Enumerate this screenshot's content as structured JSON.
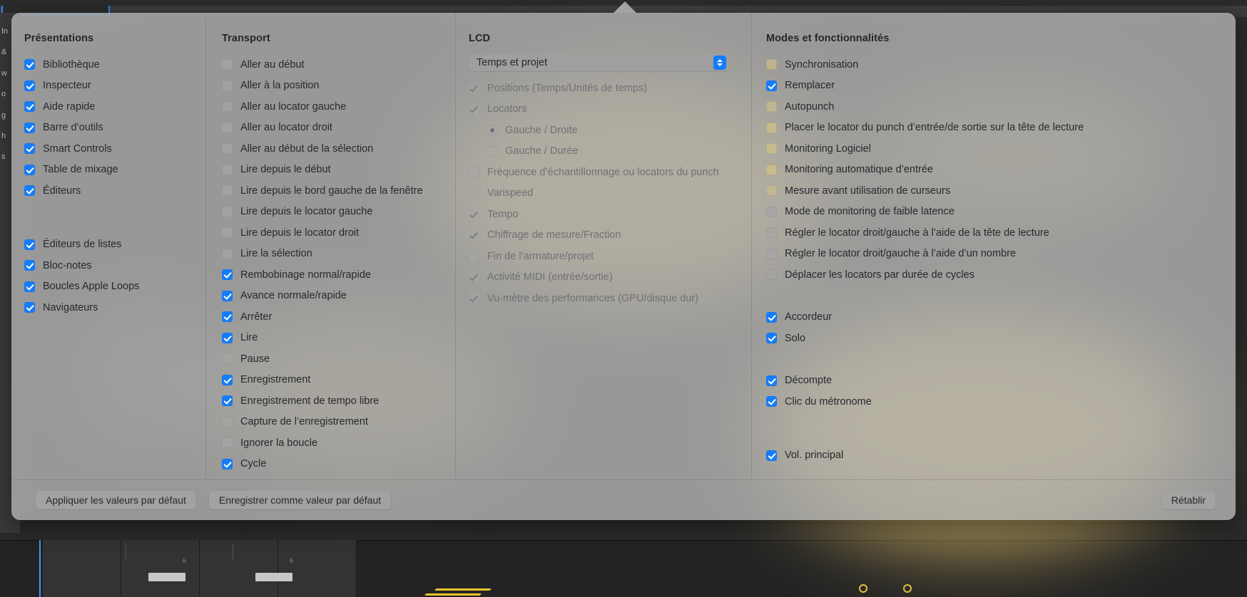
{
  "popover": {
    "columns": [
      {
        "id": "presentations",
        "title": "Présentations",
        "items": [
          {
            "label": "Bibliothèque",
            "state": "on"
          },
          {
            "label": "Inspecteur",
            "state": "on"
          },
          {
            "label": "Aide rapide",
            "state": "on"
          },
          {
            "label": "Barre d’outils",
            "state": "on"
          },
          {
            "label": "Smart Controls",
            "state": "on"
          },
          {
            "label": "Table de mixage",
            "state": "on"
          },
          {
            "label": "Éditeurs",
            "state": "on"
          },
          {
            "label": "Éditeurs de listes",
            "state": "on"
          },
          {
            "label": "Bloc-notes",
            "state": "on"
          },
          {
            "label": "Boucles Apple Loops",
            "state": "on"
          },
          {
            "label": "Navigateurs",
            "state": "on"
          }
        ]
      },
      {
        "id": "transport",
        "title": "Transport",
        "items": [
          {
            "label": "Aller au début",
            "state": "off"
          },
          {
            "label": "Aller à la position",
            "state": "off"
          },
          {
            "label": "Aller au locator gauche",
            "state": "off"
          },
          {
            "label": "Aller au locator droit",
            "state": "off"
          },
          {
            "label": "Aller au début de la sélection",
            "state": "off"
          },
          {
            "label": "Lire depuis le début",
            "state": "off"
          },
          {
            "label": "Lire depuis le bord gauche de la fenêtre",
            "state": "off"
          },
          {
            "label": "Lire depuis le locator gauche",
            "state": "off"
          },
          {
            "label": "Lire depuis le locator droit",
            "state": "off"
          },
          {
            "label": "Lire la sélection",
            "state": "off"
          },
          {
            "label": "Rembobinage normal/rapide",
            "state": "on"
          },
          {
            "label": "Avance normale/rapide",
            "state": "on"
          },
          {
            "label": "Arrêter",
            "state": "on"
          },
          {
            "label": "Lire",
            "state": "on"
          },
          {
            "label": "Pause",
            "state": "off"
          },
          {
            "label": "Enregistrement",
            "state": "on"
          },
          {
            "label": "Enregistrement de tempo libre",
            "state": "on"
          },
          {
            "label": "Capture de l’enregistrement",
            "state": "off"
          },
          {
            "label": "Ignorer la boucle",
            "state": "off"
          },
          {
            "label": "Cycle",
            "state": "on"
          }
        ]
      },
      {
        "id": "lcd",
        "title": "LCD",
        "popup": {
          "value": "Temps et projet"
        },
        "items": [
          {
            "label": "Positions (Temps/Unités de temps)",
            "state": "disabled-checked"
          },
          {
            "label": "Locators",
            "state": "disabled-checked"
          },
          {
            "label": "Gauche / Droite",
            "state": "radio-selected",
            "indent": true
          },
          {
            "label": "Gauche / Durée",
            "state": "radio",
            "indent": true
          },
          {
            "label": "Fréquence d’échantillonnage ou locators du punch",
            "state": "disabled"
          },
          {
            "label": "Varispeed",
            "state": "disabled"
          },
          {
            "label": "Tempo",
            "state": "disabled-checked"
          },
          {
            "label": "Chiffrage de mesure/Fraction",
            "state": "disabled-checked"
          },
          {
            "label": "Fin de l’armature/projet",
            "state": "disabled"
          },
          {
            "label": "Activité MIDI (entrée/sortie)",
            "state": "disabled-checked"
          },
          {
            "label": "Vu-mètre des performances (GPU/disque dur)",
            "state": "disabled-checked"
          }
        ]
      },
      {
        "id": "modes",
        "title": "Modes et fonctionnalités",
        "items": [
          {
            "label": "Synchronisation",
            "state": "off"
          },
          {
            "label": "Remplacer",
            "state": "on"
          },
          {
            "label": "Autopunch",
            "state": "off"
          },
          {
            "label": "Placer le locator du punch d’entrée/de sortie sur la tête de lecture",
            "state": "off"
          },
          {
            "label": "Monitoring Logiciel",
            "state": "off"
          },
          {
            "label": "Monitoring automatique d’entrée",
            "state": "off"
          },
          {
            "label": "Mesure avant utilisation de curseurs",
            "state": "off"
          },
          {
            "label": "Mode de monitoring de faible latence",
            "state": "off"
          },
          {
            "label": "Régler le locator droit/gauche à l’aide de la tête de lecture",
            "state": "off"
          },
          {
            "label": "Régler le locator droit/gauche à l’aide d’un nombre",
            "state": "off"
          },
          {
            "label": "Déplacer les locators par durée de cycles",
            "state": "off"
          },
          {
            "label": "Accordeur",
            "state": "on"
          },
          {
            "label": "Solo",
            "state": "on"
          },
          {
            "label": "Décompte",
            "state": "on"
          },
          {
            "label": "Clic du métronome",
            "state": "on"
          },
          {
            "label": "Vol. principal",
            "state": "on"
          }
        ]
      }
    ],
    "footer": {
      "apply_defaults": "Appliquer les valeurs par défaut",
      "save_default": "Enregistrer comme valeur par défaut",
      "revert": "Rétablir"
    }
  },
  "background": {
    "sidebar_glyphs": "In|\n&\nw\no\ng\nh\ns",
    "ruler_numbers": [
      "6",
      "6"
    ]
  },
  "colors": {
    "accent_blue": "#147dfa",
    "panel": "#b4b4b4",
    "glow_yellow": "#f0ce6e",
    "text": "#26292e",
    "text_dim": "#6f7176"
  }
}
